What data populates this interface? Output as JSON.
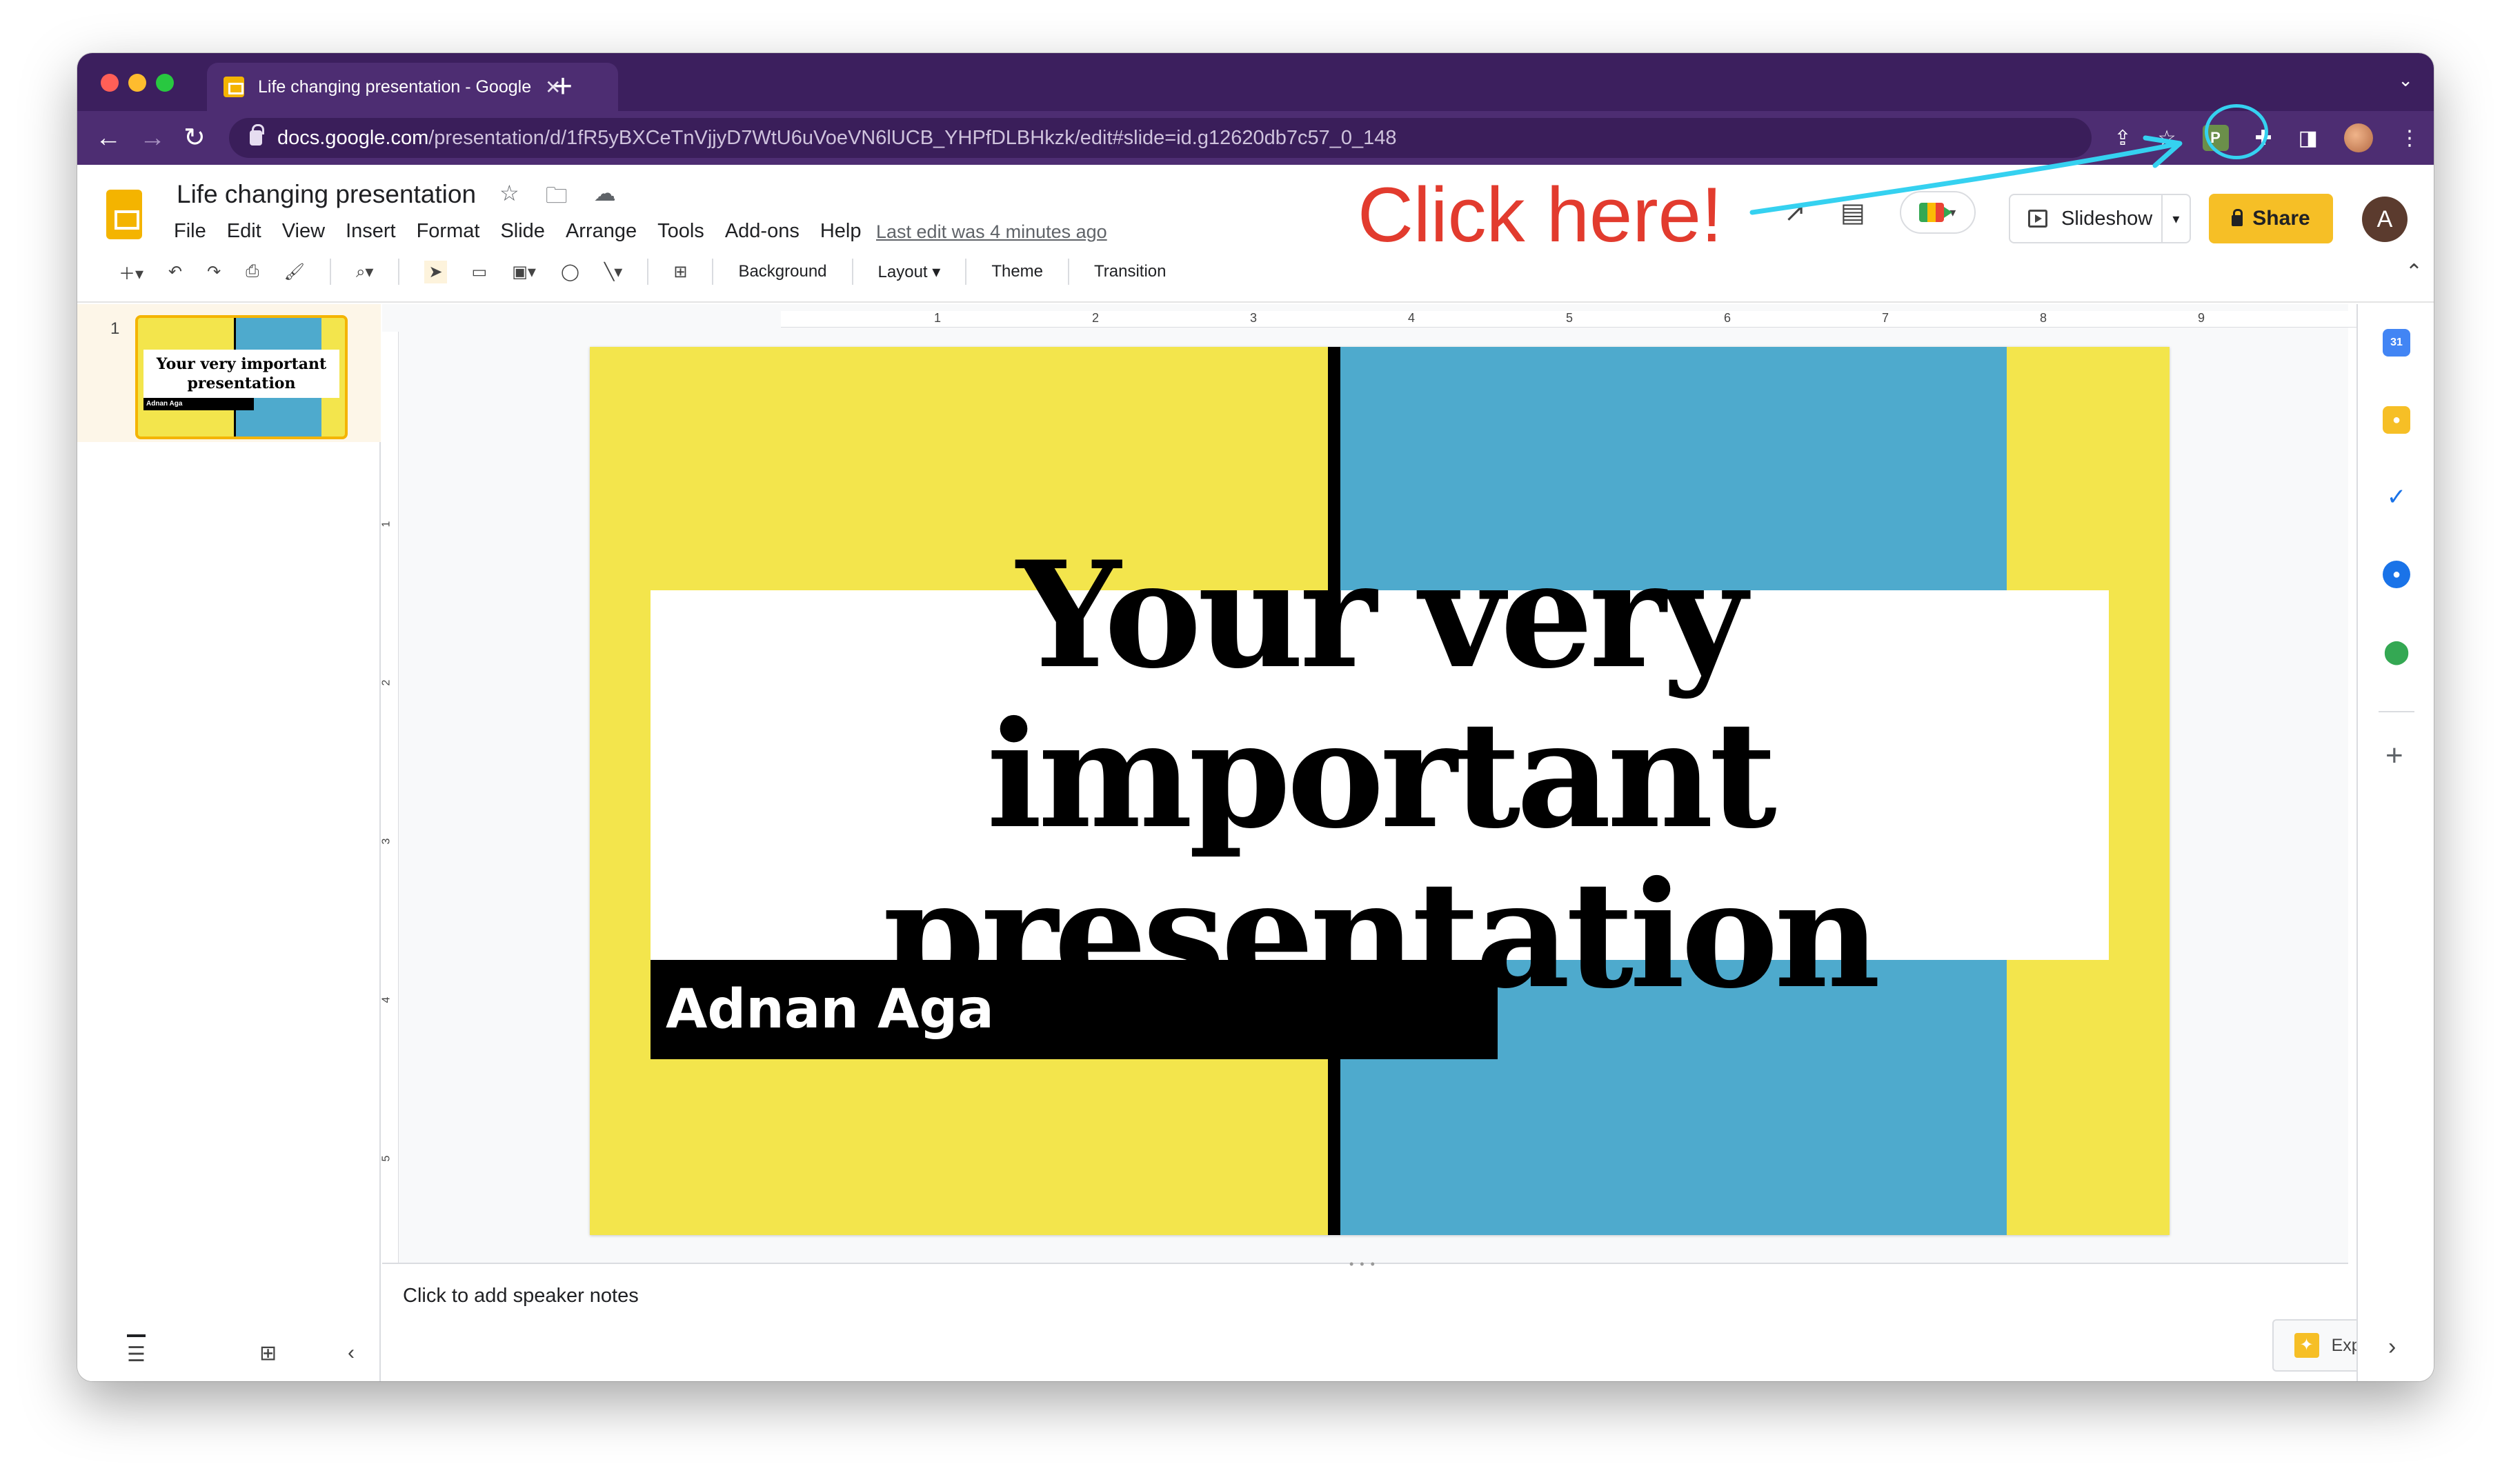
{
  "browser": {
    "tab_title": "Life changing presentation - Google Slides",
    "url_host": "docs.google.com",
    "url_path": "/presentation/d/1fR5yBXCeTnVjjyD7WtU6uVoeVN6lUCB_YHPfDLBHkzk/edit#slide=id.g12620db7c57_0_148",
    "extension_label": "P",
    "traffic_colors": [
      "#ff5f57",
      "#febc2e",
      "#28c840"
    ]
  },
  "header": {
    "doc_title": "Life changing presentation",
    "menu": [
      "File",
      "Edit",
      "View",
      "Insert",
      "Format",
      "Slide",
      "Arrange",
      "Tools",
      "Add-ons",
      "Help"
    ],
    "last_edit": "Last edit was 4 minutes ago",
    "slideshow_label": "Slideshow",
    "share_label": "Share",
    "avatar_letter": "A"
  },
  "annotation": {
    "text": "Click here!",
    "color": "#e23b2e",
    "arrow_color": "#35d1f0"
  },
  "toolbar": {
    "background_label": "Background",
    "layout_label": "Layout",
    "theme_label": "Theme",
    "transition_label": "Transition"
  },
  "filmstrip": {
    "slide_number": "1",
    "thumb_title": "Your very important presentation",
    "thumb_author": "Adnan Aga"
  },
  "ruler": {
    "h_marks": [
      "1",
      "2",
      "3",
      "4",
      "5",
      "6",
      "7",
      "8",
      "9"
    ],
    "v_marks": [
      "1",
      "2",
      "3",
      "4",
      "5"
    ]
  },
  "slide": {
    "title": "Your very important presentation",
    "author": "Adnan Aga",
    "colors": {
      "yellow": "#f3e54c",
      "blue": "#4eaacd",
      "black": "#000000",
      "white": "#ffffff"
    }
  },
  "notes": {
    "placeholder": "Click to add speaker notes"
  },
  "explore": {
    "label": "Explore"
  },
  "side_panel": {
    "icons": [
      "calendar-icon",
      "keep-icon",
      "tasks-icon",
      "contacts-icon",
      "maps-icon"
    ],
    "calendar_label": "31"
  }
}
